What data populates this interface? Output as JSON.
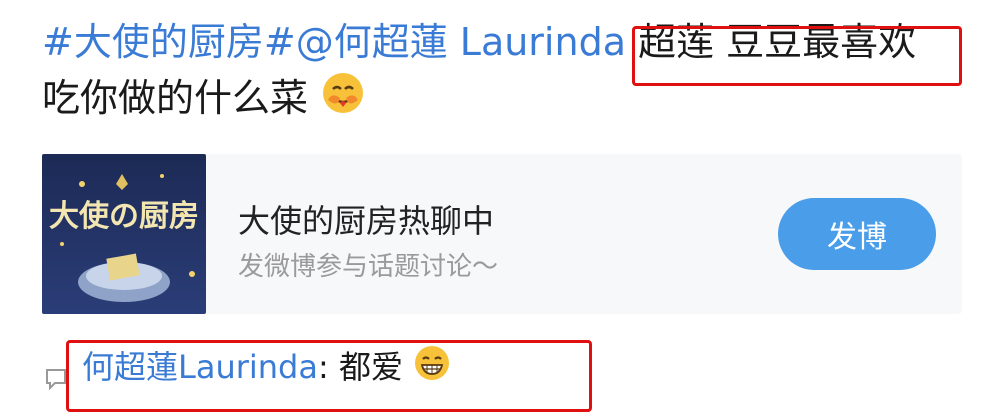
{
  "post": {
    "topic": "#大使的厨房#",
    "at": "@",
    "mention": "何超蓮 Laurinda",
    "highlight_text": "超莲 豆豆最喜欢",
    "line2_text": "吃你做的什么菜",
    "emoji1": "hug-face-emoji"
  },
  "card": {
    "title": "大使的厨房热聊中",
    "subtitle": "发微博参与话题讨论～",
    "button_label": "发博",
    "thumb_text": "大使の厨房"
  },
  "comment": {
    "author": "何超蓮Laurinda",
    "colon": ":",
    "text": "都爱",
    "emoji": "grin-face-emoji"
  },
  "colors": {
    "link": "#3a7bd5",
    "highlight_border": "#e01010",
    "button": "#4a9de8"
  }
}
